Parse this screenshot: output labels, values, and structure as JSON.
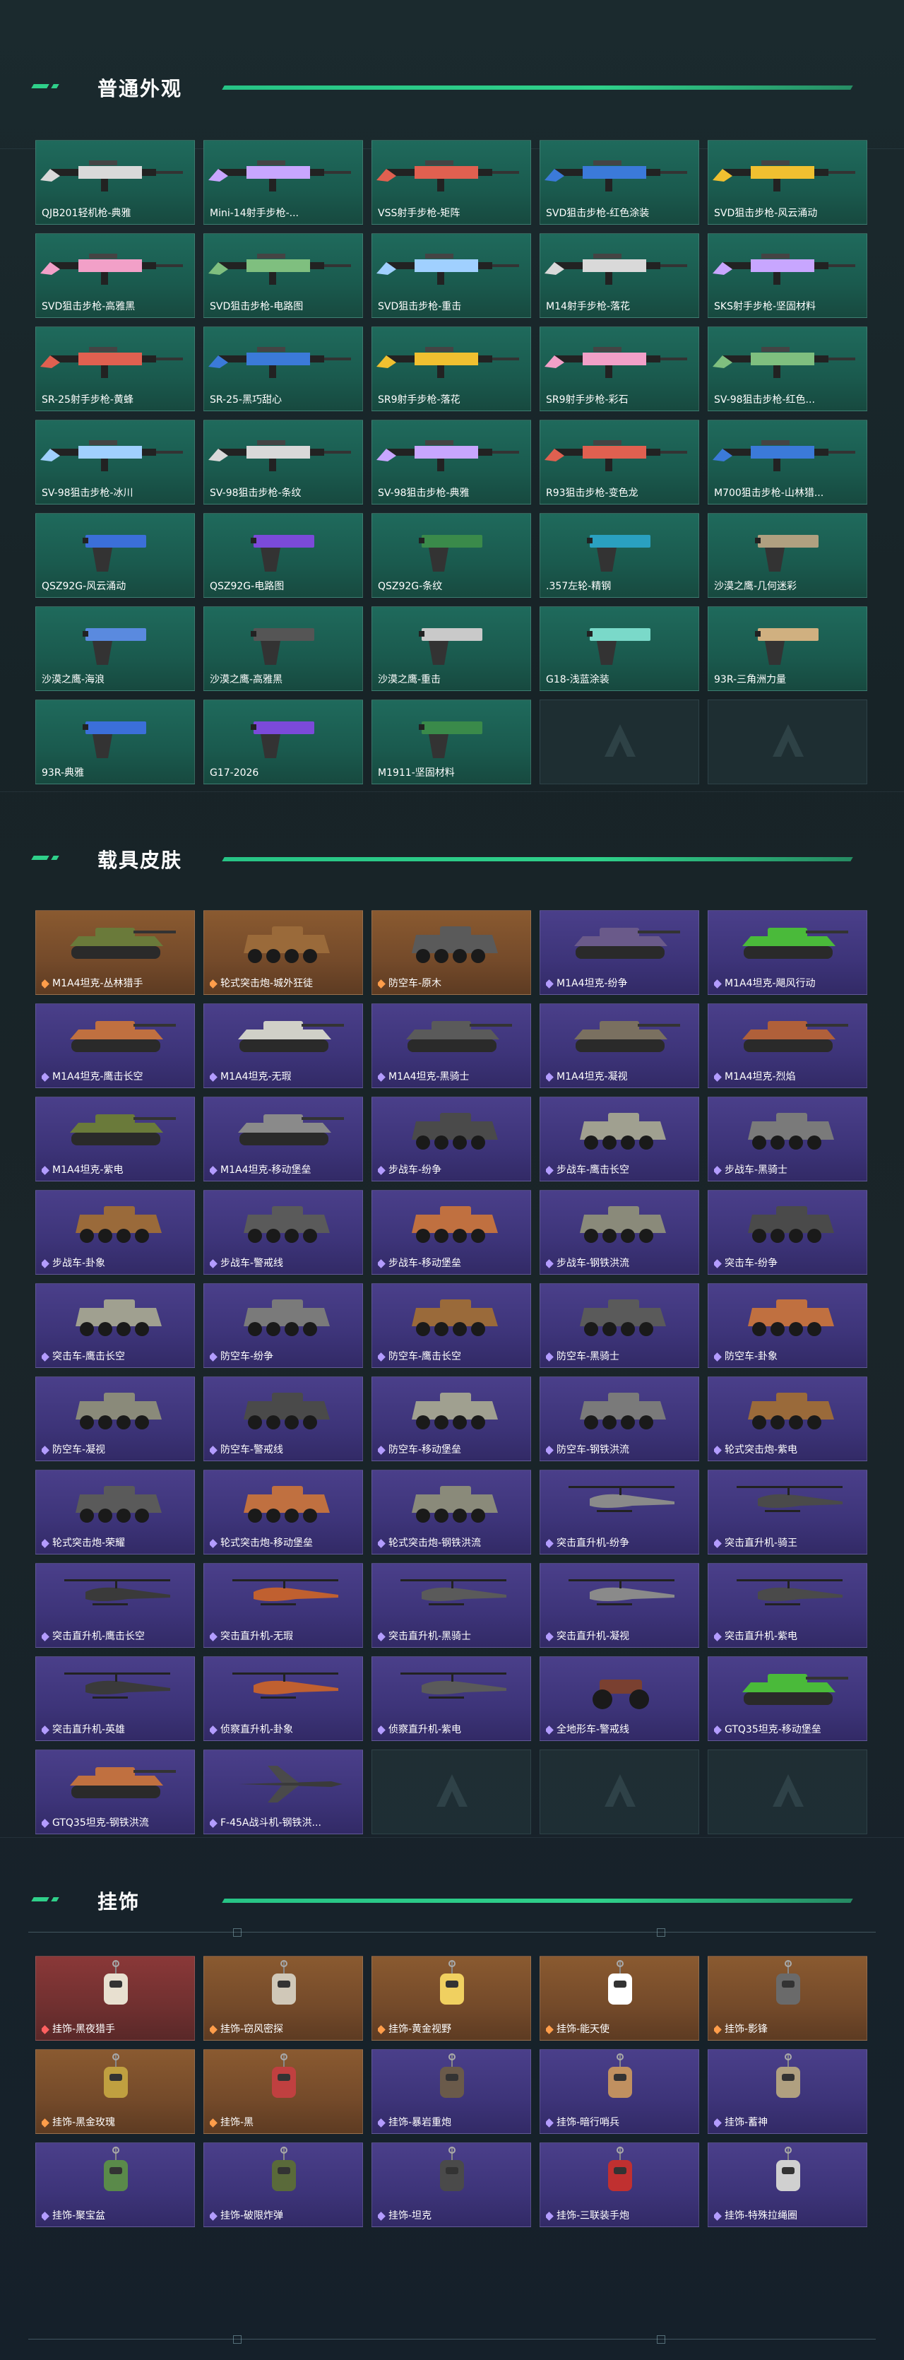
{
  "sections": {
    "weapons": {
      "title": "普通外观",
      "items": [
        "QJB201轻机枪-典雅",
        "Mini-14射手步枪-...",
        "VSS射手步枪-矩阵",
        "SVD狙击步枪-红色涂装",
        "SVD狙击步枪-风云涌动",
        "SVD狙击步枪-高雅黑",
        "SVD狙击步枪-电路图",
        "SVD狙击步枪-重击",
        "M14射手步枪-落花",
        "SKS射手步枪-坚固材料",
        "SR-25射手步枪-黄蜂",
        "SR-25-黑巧甜心",
        "SR9射手步枪-落花",
        "SR9射手步枪-彩石",
        "SV-98狙击步枪-红色...",
        "SV-98狙击步枪-冰川",
        "SV-98狙击步枪-条纹",
        "SV-98狙击步枪-典雅",
        "R93狙击步枪-变色龙",
        "M700狙击步枪-山林猎...",
        "QSZ92G-风云涌动",
        "QSZ92G-电路图",
        "QSZ92G-条纹",
        ".357左轮-精钢",
        "沙漠之鹰-几何迷彩",
        "沙漠之鹰-海浪",
        "沙漠之鹰-高雅黑",
        "沙漠之鹰-重击",
        "G18-浅蓝涂装",
        "93R-三角洲力量",
        "93R-典雅",
        "G17-2026",
        "M1911-坚固材料"
      ]
    },
    "vehicles": {
      "title": "载具皮肤",
      "items": [
        "M1A4坦克-丛林猎手",
        "轮式突击炮-城外狂徒",
        "防空车-原木",
        "M1A4坦克-纷争",
        "M1A4坦克-飓风行动",
        "M1A4坦克-鹰击长空",
        "M1A4坦克-无瑕",
        "M1A4坦克-黑骑士",
        "M1A4坦克-凝视",
        "M1A4坦克-烈焰",
        "M1A4坦克-紫电",
        "M1A4坦克-移动堡垒",
        "步战车-纷争",
        "步战车-鹰击长空",
        "步战车-黑骑士",
        "步战车-卦象",
        "步战车-警戒线",
        "步战车-移动堡垒",
        "步战车-钢铁洪流",
        "突击车-纷争",
        "突击车-鹰击长空",
        "防空车-纷争",
        "防空车-鹰击长空",
        "防空车-黑骑士",
        "防空车-卦象",
        "防空车-凝视",
        "防空车-警戒线",
        "防空车-移动堡垒",
        "防空车-钢铁洪流",
        "轮式突击炮-紫电",
        "轮式突击炮-荣耀",
        "轮式突击炮-移动堡垒",
        "轮式突击炮-钢铁洪流",
        "突击直升机-纷争",
        "突击直升机-骑王",
        "突击直升机-鹰击长空",
        "突击直升机-无瑕",
        "突击直升机-黑骑士",
        "突击直升机-凝视",
        "突击直升机-紫电",
        "突击直升机-英雄",
        "侦察直升机-卦象",
        "侦察直升机-紫电",
        "全地形车-警戒线",
        "GTQ35坦克-移动堡垒",
        "GTQ35坦克-钢铁洪流",
        "F-45A战斗机-钢铁洪..."
      ]
    },
    "charms": {
      "title": "挂饰",
      "items": [
        "挂饰-黑夜猎手",
        "挂饰-窃风密探",
        "挂饰-黄金视野",
        "挂饰-能天使",
        "挂饰-影锋",
        "挂饰-黑金玫瑰",
        "挂饰-黑",
        "挂饰-暴岩重炮",
        "挂饰-暗行哨兵",
        "挂饰-蓄神",
        "挂饰-聚宝盆",
        "挂饰-破限炸弹",
        "挂饰-坦克",
        "挂饰-三联装手炮",
        "挂饰-特殊拉绳圈"
      ]
    }
  },
  "colors": {
    "accent": "#2fd08a",
    "green_card": "#1f6a5c",
    "purple_card": "#4a3f8a",
    "orange_card": "#8a5a30",
    "red_card": "#8a3838"
  }
}
